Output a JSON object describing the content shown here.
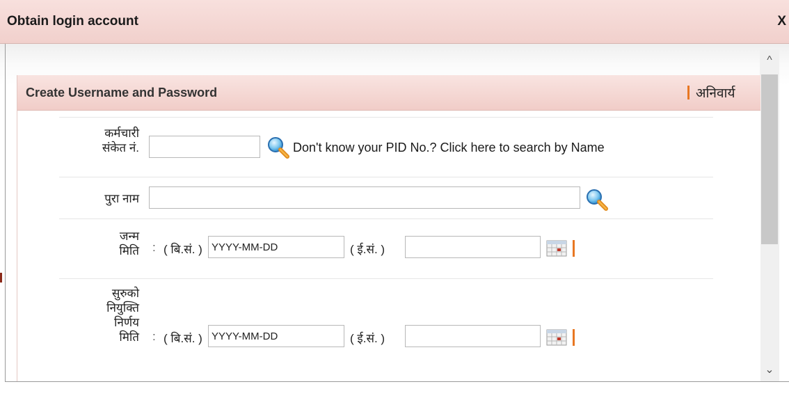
{
  "dialog": {
    "title": "Obtain login account",
    "close_label": "X"
  },
  "panel": {
    "title": "Create Username and Password",
    "required_note": "अनिवार्य"
  },
  "form": {
    "colon": ":",
    "pid": {
      "label_line1": "कर्मचारी",
      "label_line2": "संकेत नं.",
      "value": "",
      "search_link": "Don't know your PID No.? Click here to search by Name"
    },
    "full_name": {
      "label": "पुरा नाम",
      "value": ""
    },
    "dob": {
      "label_line1": "जन्म",
      "label_line2": "मिति",
      "bs_label": "( बि.सं. )",
      "bs_value": "YYYY-MM-DD",
      "ad_label": "( ई.सं. )",
      "ad_value": ""
    },
    "appointment": {
      "label_line1": "सुरुको",
      "label_line2": "नियुक्ति",
      "label_line3": "निर्णय",
      "label_line4": "मिति",
      "bs_label": "( बि.सं. )",
      "bs_value": "YYYY-MM-DD",
      "ad_label": "( ई.सं. )",
      "ad_value": ""
    }
  },
  "scrollbar": {
    "up_glyph": "^",
    "down_glyph": "⌄"
  },
  "colors": {
    "header_pink": "#f1d0cc",
    "required_orange": "#e87722"
  }
}
